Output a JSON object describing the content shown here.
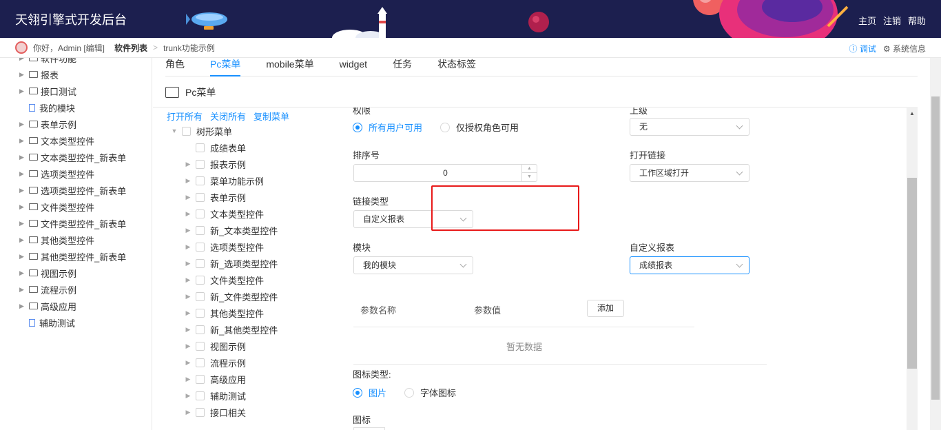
{
  "header": {
    "title": "天翎引擎式开发后台",
    "nav": [
      "主页",
      "注销",
      "帮助"
    ]
  },
  "crumb": {
    "greeting": "你好，Admin [编辑]",
    "items": [
      "软件列表",
      "trunk功能示例"
    ],
    "debug": "调试",
    "sysinfo": "系统信息"
  },
  "leftnav": {
    "items": [
      {
        "label": "软件功能",
        "type": "folder"
      },
      {
        "label": "报表",
        "type": "folder"
      },
      {
        "label": "接口测试",
        "type": "folder"
      },
      {
        "label": "我的模块",
        "type": "doc"
      },
      {
        "label": "表单示例",
        "type": "folder"
      },
      {
        "label": "文本类型控件",
        "type": "folder"
      },
      {
        "label": "文本类型控件_新表单",
        "type": "folder"
      },
      {
        "label": "选项类型控件",
        "type": "folder"
      },
      {
        "label": "选项类型控件_新表单",
        "type": "folder"
      },
      {
        "label": "文件类型控件",
        "type": "folder"
      },
      {
        "label": "文件类型控件_新表单",
        "type": "folder"
      },
      {
        "label": "其他类型控件",
        "type": "folder"
      },
      {
        "label": "其他类型控件_新表单",
        "type": "folder"
      },
      {
        "label": "视图示例",
        "type": "folder"
      },
      {
        "label": "流程示例",
        "type": "folder"
      },
      {
        "label": "高级应用",
        "type": "folder"
      },
      {
        "label": "辅助测试",
        "type": "doc"
      }
    ]
  },
  "tabs": [
    "角色",
    "Pc菜单",
    "mobile菜单",
    "widget",
    "任务",
    "状态标签"
  ],
  "section_title": "Pc菜单",
  "tree_ops": [
    "打开所有",
    "关闭所有",
    "复制菜单"
  ],
  "tree": {
    "root": "树形菜单",
    "children": [
      {
        "label": "成绩表单",
        "arrow": false
      },
      {
        "label": "报表示例",
        "arrow": true
      },
      {
        "label": "菜单功能示例",
        "arrow": true
      },
      {
        "label": "表单示例",
        "arrow": true
      },
      {
        "label": "文本类型控件",
        "arrow": true
      },
      {
        "label": "新_文本类型控件",
        "arrow": true
      },
      {
        "label": "选项类型控件",
        "arrow": true
      },
      {
        "label": "新_选项类型控件",
        "arrow": true
      },
      {
        "label": "文件类型控件",
        "arrow": true
      },
      {
        "label": "新_文件类型控件",
        "arrow": true
      },
      {
        "label": "其他类型控件",
        "arrow": true
      },
      {
        "label": "新_其他类型控件",
        "arrow": true
      },
      {
        "label": "视图示例",
        "arrow": true
      },
      {
        "label": "流程示例",
        "arrow": true
      },
      {
        "label": "高级应用",
        "arrow": true
      },
      {
        "label": "辅助测试",
        "arrow": true
      },
      {
        "label": "接口相关",
        "arrow": true
      }
    ]
  },
  "form": {
    "permission_label": "权限",
    "permission_opt1": "所有用户可用",
    "permission_opt2": "仅授权角色可用",
    "superior_label": "上级",
    "superior_value": "无",
    "order_label": "排序号",
    "order_value": "0",
    "open_link_label": "打开链接",
    "open_link_value": "工作区域打开",
    "link_type_label": "链接类型",
    "link_type_value": "自定义报表",
    "module_label": "模块",
    "module_value": "我的模块",
    "custom_report_label": "自定义报表",
    "custom_report_value": "成绩报表",
    "param_name_header": "参数名称",
    "param_value_header": "参数值",
    "add_button": "添加",
    "empty_text": "暂无数据",
    "icon_type_label": "图标类型:",
    "icon_type_opt1": "图片",
    "icon_type_opt2": "字体图标",
    "icon_label": "图标"
  },
  "colors": {
    "header_bg": "#1c1f4f",
    "accent": "#1890ff",
    "highlight": "#e81919"
  }
}
